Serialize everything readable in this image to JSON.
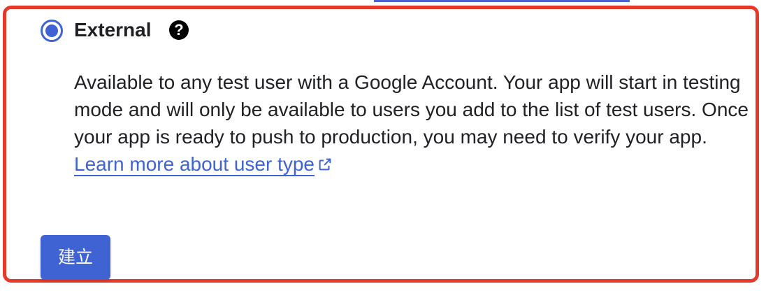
{
  "user_type_option": {
    "label": "External",
    "selected": true,
    "help_icon": "question-circle-icon",
    "description_text": "Available to any test user with a Google Account. Your app will start in testing mode and will only be available to users you add to the list of test users. Once your app is ready to push to production, you may need to verify your app. ",
    "learn_more_link_text": "Learn more about user type",
    "external_link_icon": "external-link-icon"
  },
  "actions": {
    "create_button_label": "建立"
  },
  "colors": {
    "accent_blue": "#3f63d3",
    "highlight_red": "#e5392a",
    "text_dark": "#202124"
  }
}
